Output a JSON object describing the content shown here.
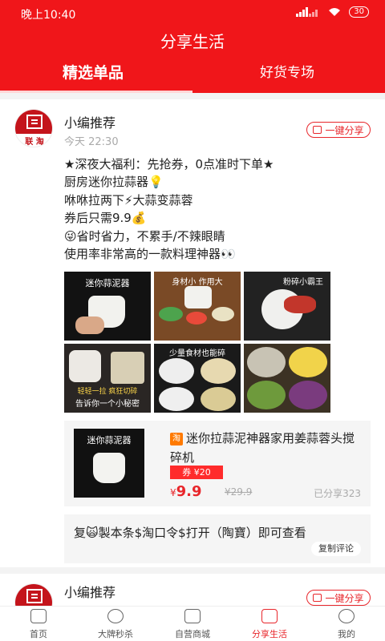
{
  "status": {
    "time": "晚上10:40",
    "battery": "30"
  },
  "header": {
    "title": "分享生活",
    "tabs": [
      {
        "label": "精选单品"
      },
      {
        "label": "好货专场"
      }
    ]
  },
  "post": {
    "avatar_text": "联 淘",
    "author": "小编推荐",
    "time": "今天 22:30",
    "share_label": "一键分享",
    "lines": [
      "★深夜大福利：先抢券，0点准时下单★",
      "厨房迷你拉蒜器💡",
      "咻咻拉两下⚡大蒜变蒜蓉",
      "券后只需9.9💰",
      "😜省时省力，不累手/不辣眼睛",
      "使用率非常高的一款料理神器👀"
    ],
    "images": [
      {
        "caption": "迷你蒜泥器"
      },
      {
        "caption": "身材小 作用大"
      },
      {
        "caption": "粉碎小霸王"
      },
      {
        "caption": "轻轻一拉  疯狂切碎",
        "sub": "告诉你一个小秘密"
      },
      {
        "caption": "少量食材也能碎"
      },
      {
        "caption": ""
      }
    ],
    "product": {
      "thumb_caption": "迷你蒜泥器",
      "platform_icon": "淘",
      "title": "迷你拉蒜泥神器家用姜蒜蓉头搅碎机",
      "coupon": "券 ¥20",
      "currency": "¥",
      "price": "9.9",
      "original_price": "¥29.9",
      "shared": "已分享323"
    },
    "tao_code": "复🙀製本条$淘口令$打开（陶寶）即可查看",
    "copy_label": "复制评论"
  },
  "post2": {
    "author": "小编推荐",
    "share_label": "一键分享",
    "avatar_text": "联 淘"
  },
  "tabbar": {
    "items": [
      {
        "label": "首页"
      },
      {
        "label": "大牌秒杀"
      },
      {
        "label": "自营商城"
      },
      {
        "label": "分享生活"
      },
      {
        "label": "我的"
      }
    ]
  },
  "colors": {
    "brand": "#f0161a",
    "accent": "#e8262b"
  }
}
